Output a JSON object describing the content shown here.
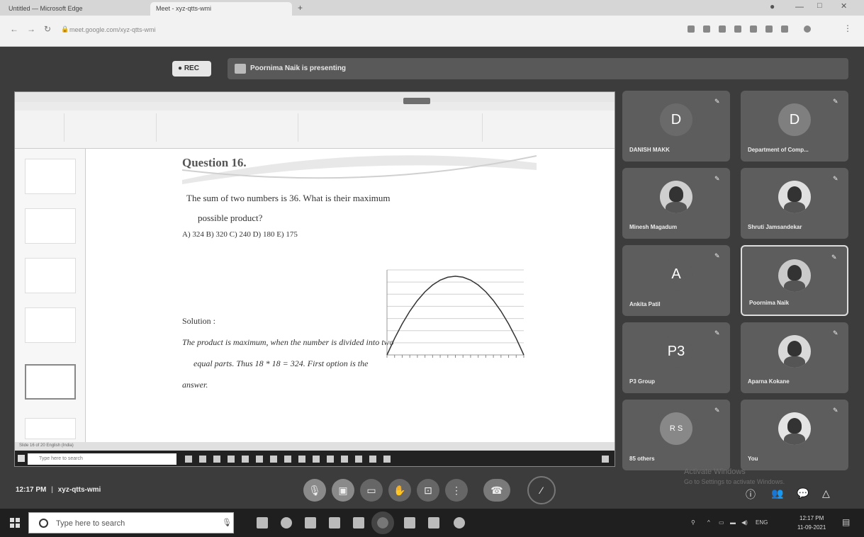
{
  "browser": {
    "tabs": [
      {
        "label": "Untitled — Microsoft Edge",
        "active": false
      },
      {
        "label": "Meet - xyz-qtts-wmi",
        "active": true
      }
    ],
    "url": "meet.google.com/xyz-qtts-wmi"
  },
  "meet": {
    "rec_label": "REC",
    "presenting_text": "Poornima Naik is presenting",
    "time_label": "12:17 PM",
    "meeting_code": "xyz-qtts-wmi",
    "participants": [
      {
        "name": "DANISH MAKK",
        "initial": "D",
        "avatar": "letter",
        "color": "#6a6a6a"
      },
      {
        "name": "Department of Comp...",
        "initial": "D",
        "avatar": "letter",
        "color": "#7f7f7f"
      },
      {
        "name": "Minesh Magadum",
        "initial": "",
        "avatar": "photo",
        "color": "#cfcfcf"
      },
      {
        "name": "Shruti Jamsandekar",
        "initial": "",
        "avatar": "photo",
        "color": "#e0e0e0"
      },
      {
        "name": "Ankita Patil",
        "initial": "A",
        "avatar": "letter",
        "color": "#5d5d5d"
      },
      {
        "name": "Poornima Naik",
        "initial": "",
        "avatar": "photo",
        "color": "#cacaca"
      },
      {
        "name": "P3 Group",
        "initial": "P3",
        "avatar": "letter",
        "color": "#5d5d5d"
      },
      {
        "name": "Aparna Kokane",
        "initial": "",
        "avatar": "photo",
        "color": "#d9d9d9"
      },
      {
        "name": "85 others",
        "initial": "R S",
        "avatar": "group",
        "color": "#888888"
      },
      {
        "name": "You",
        "initial": "",
        "avatar": "photo",
        "color": "#e4e4e4"
      }
    ],
    "watermark_line1": "Activate Windows",
    "watermark_line2": "Go to Settings to activate Windows."
  },
  "slide": {
    "title": "Question 16.",
    "question_line1": "The sum of two numbers is 36. What is their maximum",
    "question_line2": "possible product?",
    "options": "A) 324 B) 320 C) 240 D) 180 E) 175",
    "solution_head": "Solution :",
    "solution_line1": "The product is maximum, when the number is divided into two",
    "solution_line2": "equal parts. Thus 18 * 18 = 324. First option is the",
    "solution_line3": "answer."
  },
  "chart_data": {
    "type": "line",
    "x": [
      0,
      2,
      4,
      6,
      8,
      10,
      12,
      14,
      16,
      18,
      20,
      22,
      24,
      26,
      28,
      30,
      32,
      34,
      36
    ],
    "series": [
      {
        "values": [
          0,
          68,
          128,
          180,
          224,
          260,
          288,
          308,
          320,
          324,
          320,
          308,
          288,
          260,
          224,
          180,
          128,
          68,
          0
        ]
      }
    ],
    "ylim": [
      0,
      350
    ],
    "grid": true
  },
  "taskbar": {
    "search_placeholder": "Type here to search",
    "clock_time": "12:17 PM",
    "clock_date": "11-09-2021",
    "lang": "ENG"
  },
  "inner_screen": {
    "search_placeholder": "Type here to search",
    "status_text": "Slide 16 of 20   English (India)"
  }
}
